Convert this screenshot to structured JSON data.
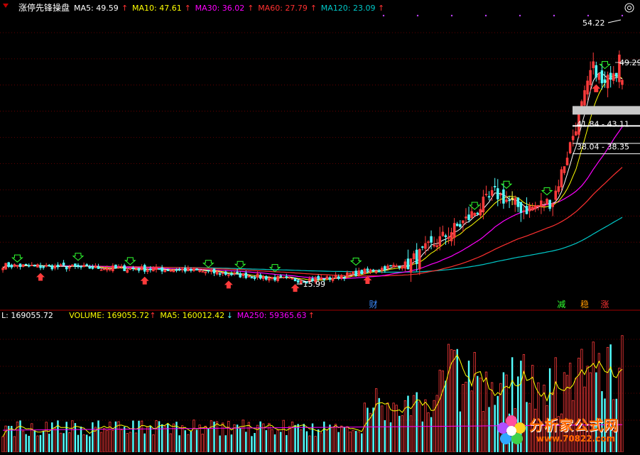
{
  "colors": {
    "up": "#ff3b3b",
    "down": "#54ffff",
    "doji": "#ffff54",
    "ma5": "#ffffff",
    "ma10": "#ffff00",
    "ma30": "#ff00ff",
    "ma60": "#ff3030",
    "ma120": "#00c8c8",
    "vol_ma5": "#ffff00",
    "vol_ma250": "#ff00ff",
    "grid": "#7a0000",
    "text_white": "#ffffff",
    "text_red": "#ff3232"
  },
  "top_legend": {
    "title": "涨停先锋操盘",
    "items": [
      {
        "label": "MA5: 49.59",
        "color": "#ffffff"
      },
      {
        "label": "MA10: 47.61",
        "color": "#ffff00"
      },
      {
        "label": "MA30: 36.02",
        "color": "#ff00ff"
      },
      {
        "label": "MA60: 27.79",
        "color": "#ff3030"
      },
      {
        "label": "MA120: 23.09",
        "color": "#00c8c8"
      }
    ]
  },
  "bottom_legend": {
    "items": [
      {
        "label": "L: 169055.72",
        "color": "#ffffff"
      },
      {
        "label": "VOLUME: 169055.72",
        "color": "#ffff00"
      },
      {
        "label": "MA5: 160012.42",
        "color": "#ffff00"
      },
      {
        "label": "MA250: 59365.63",
        "color": "#ff00ff"
      }
    ]
  },
  "chart_data": [
    {
      "type": "candlestick",
      "price_range": [
        12,
        60
      ],
      "high_label": "54.22",
      "low_label": "15.99",
      "current_label": "49.29",
      "zone_labels": [
        "41.84 - 43.11",
        "38.04 - 38.35"
      ],
      "zone_values": [
        [
          41.84,
          43.11
        ],
        [
          38.04,
          38.35
        ]
      ],
      "bottom_markers": [
        {
          "text": "财",
          "color": "#3c8cff",
          "index": 128
        },
        {
          "text": "减",
          "color": "#30ff30",
          "index": 193
        },
        {
          "text": "稳",
          "color": "#ff9900",
          "index": 201
        },
        {
          "text": "涨",
          "color": "#ff3232",
          "index": 208
        }
      ],
      "ma_last": {
        "MA5": 49.59,
        "MA10": 47.61,
        "MA30": 36.02,
        "MA60": 27.79,
        "MA120": 23.09
      }
    },
    {
      "type": "bar",
      "series_name": "VOLUME",
      "last_volume": 169055.72,
      "ma5_last": 160012.42,
      "ma250_last": 59365.63
    }
  ],
  "watermark": {
    "name": "分析家公式网",
    "url": "www.70822.com"
  }
}
